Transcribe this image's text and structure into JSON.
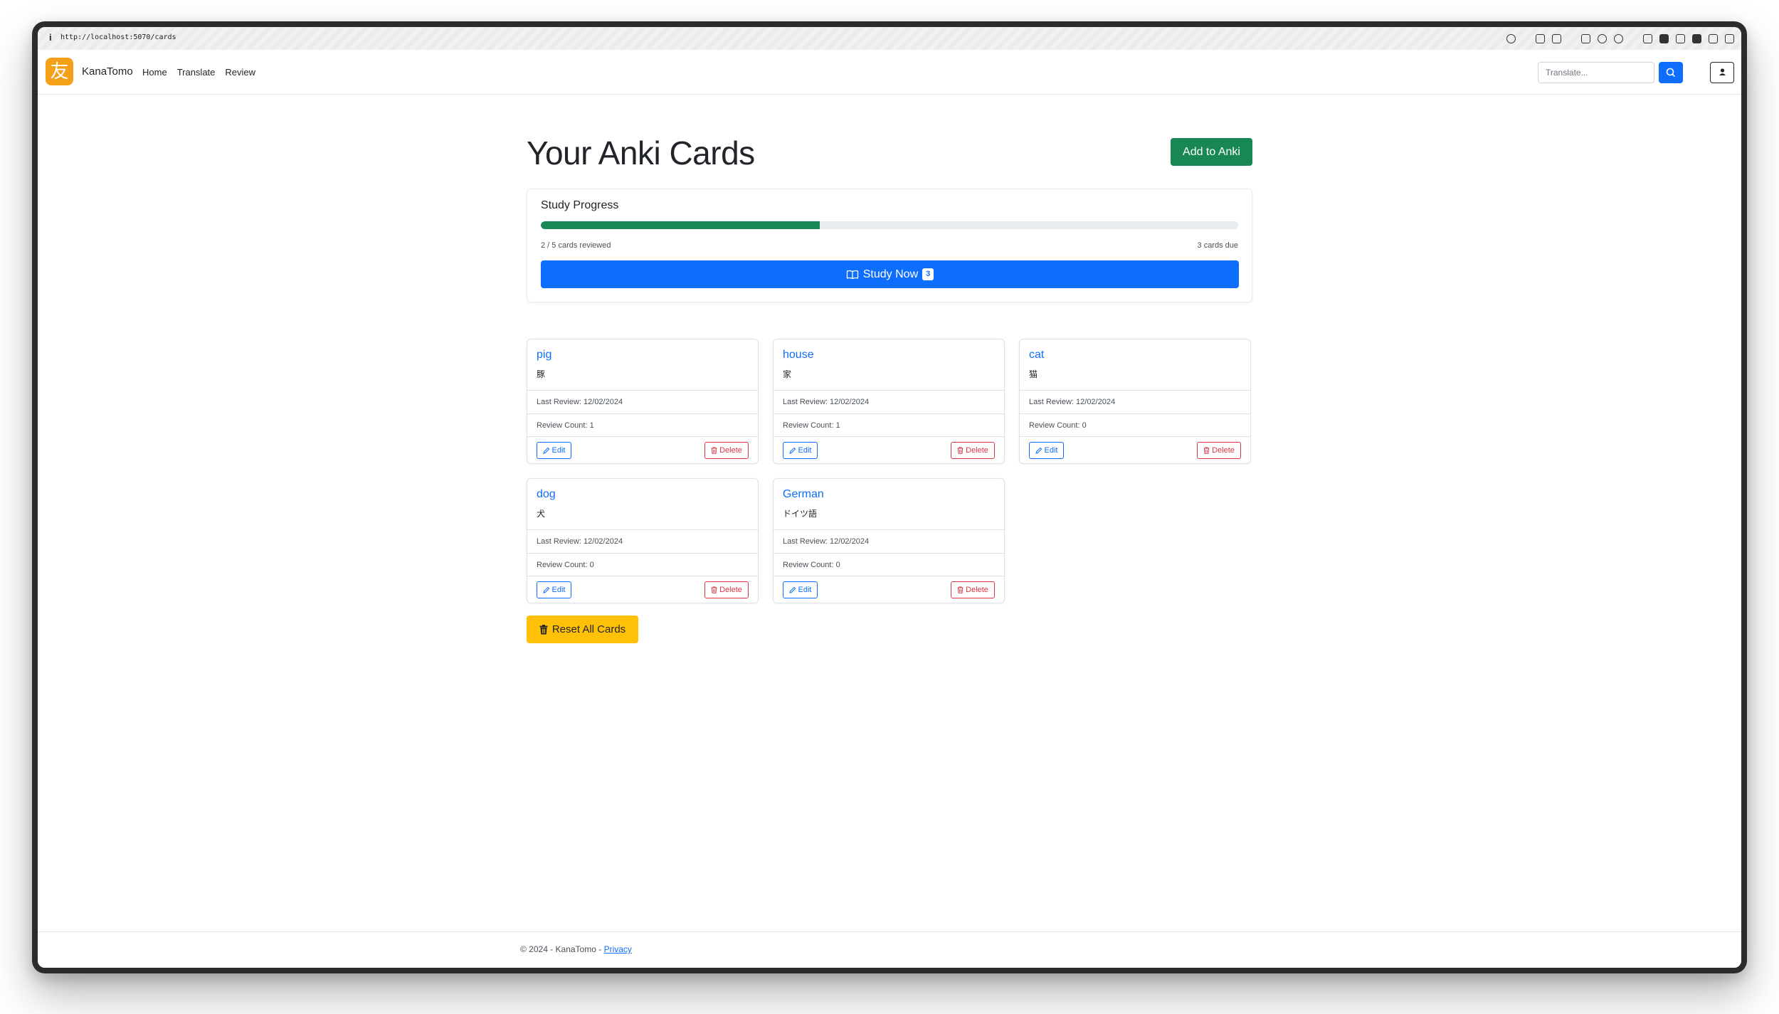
{
  "browser": {
    "url": "http://localhost:5070/cards",
    "info_icon": "i"
  },
  "navbar": {
    "logo_char": "友",
    "brand": "KanaTomo",
    "links": [
      "Home",
      "Translate",
      "Review"
    ],
    "search_placeholder": "Translate..."
  },
  "page": {
    "title": "Your Anki Cards",
    "add_button": "Add to Anki"
  },
  "progress": {
    "title": "Study Progress",
    "reviewed_text": "2 / 5 cards reviewed",
    "due_text": "3 cards due",
    "fraction": 0.4,
    "study_button": "Study Now",
    "study_badge": "3"
  },
  "cards": [
    {
      "word": "pig",
      "translation": "豚",
      "last_review": "Last Review: 12/02/2024",
      "review_count": "Review Count: 1",
      "edit": "Edit",
      "delete": "Delete"
    },
    {
      "word": "house",
      "translation": "家",
      "last_review": "Last Review: 12/02/2024",
      "review_count": "Review Count: 1",
      "edit": "Edit",
      "delete": "Delete"
    },
    {
      "word": "cat",
      "translation": "猫",
      "last_review": "Last Review: 12/02/2024",
      "review_count": "Review Count: 0",
      "edit": "Edit",
      "delete": "Delete"
    },
    {
      "word": "dog",
      "translation": "犬",
      "last_review": "Last Review: 12/02/2024",
      "review_count": "Review Count: 0",
      "edit": "Edit",
      "delete": "Delete"
    },
    {
      "word": "German",
      "translation": "ドイツ語",
      "last_review": "Last Review: 12/02/2024",
      "review_count": "Review Count: 0",
      "edit": "Edit",
      "delete": "Delete"
    }
  ],
  "reset_button": "Reset All Cards",
  "footer": {
    "text": "© 2024 - KanaTomo - ",
    "privacy": "Privacy"
  },
  "colors": {
    "primary": "#0d6efd",
    "success": "#198754",
    "danger": "#dc3545",
    "warning": "#ffc107",
    "brand": "#f5a019"
  },
  "icons": {
    "search": "search-icon",
    "user": "user-icon",
    "book": "book-icon",
    "pencil": "pencil-icon",
    "trash": "trash-icon"
  }
}
